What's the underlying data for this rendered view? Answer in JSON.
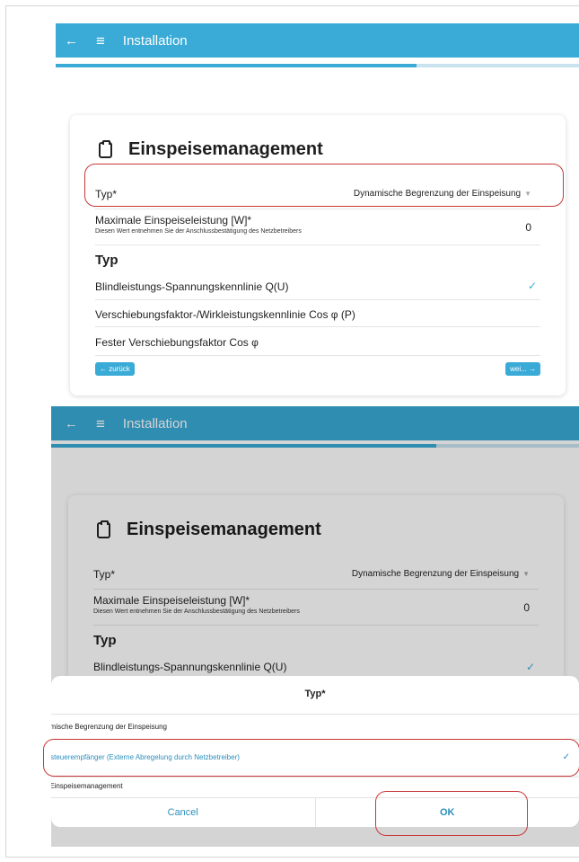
{
  "colors": {
    "accent": "#3aaad6",
    "highlight": "#c8383a"
  },
  "screen1": {
    "appbar": {
      "back_icon": "←",
      "menu_icon": "≡",
      "title": "Installation"
    },
    "progress": 0.69,
    "card": {
      "title": "Einspeisemanagement",
      "typ_label": "Typ*",
      "typ_value": "Dynamische Begrenzung der Einspeisung",
      "max_label": "Maximale Einspeiseleistung [W]*",
      "max_hint": "Diesen Wert entnehmen Sie der Anschlussbestätigung des Netzbetreibers",
      "max_value": "0",
      "section": "Typ",
      "options": [
        "Blindleistungs-Spannungskennlinie Q(U)",
        "Verschiebungsfaktor-/Wirkleistungskennlinie Cos φ (P)",
        "Fester Verschiebungsfaktor Cos φ"
      ],
      "back_btn": "← zurück",
      "next_btn": "wei... →"
    }
  },
  "screen2": {
    "appbar": {
      "back_icon": "←",
      "menu_icon": "≡",
      "title": "Installation"
    },
    "progress": 0.73,
    "card": {
      "title": "Einspeisemanagement",
      "typ_label": "Typ*",
      "typ_value": "Dynamische Begrenzung der Einspeisung",
      "max_label": "Maximale Einspeiseleistung [W]*",
      "max_hint": "Diesen Wert entnehmen Sie der Anschlussbestätigung des Netzbetreibers",
      "max_value": "0",
      "section": "Typ",
      "option1": "Blindleistungs-Spannungskennlinie Q(U)"
    },
    "sheet": {
      "title": "Typ*",
      "options": [
        "Dynamische Begrenzung der Einspeisung",
        "Rundsteuerempfänger (Externe Abregelung durch Netzbetreiber)",
        "Kein Einspeisemanagement"
      ],
      "cancel": "Cancel",
      "ok": "OK"
    }
  },
  "check_icon": "✓"
}
